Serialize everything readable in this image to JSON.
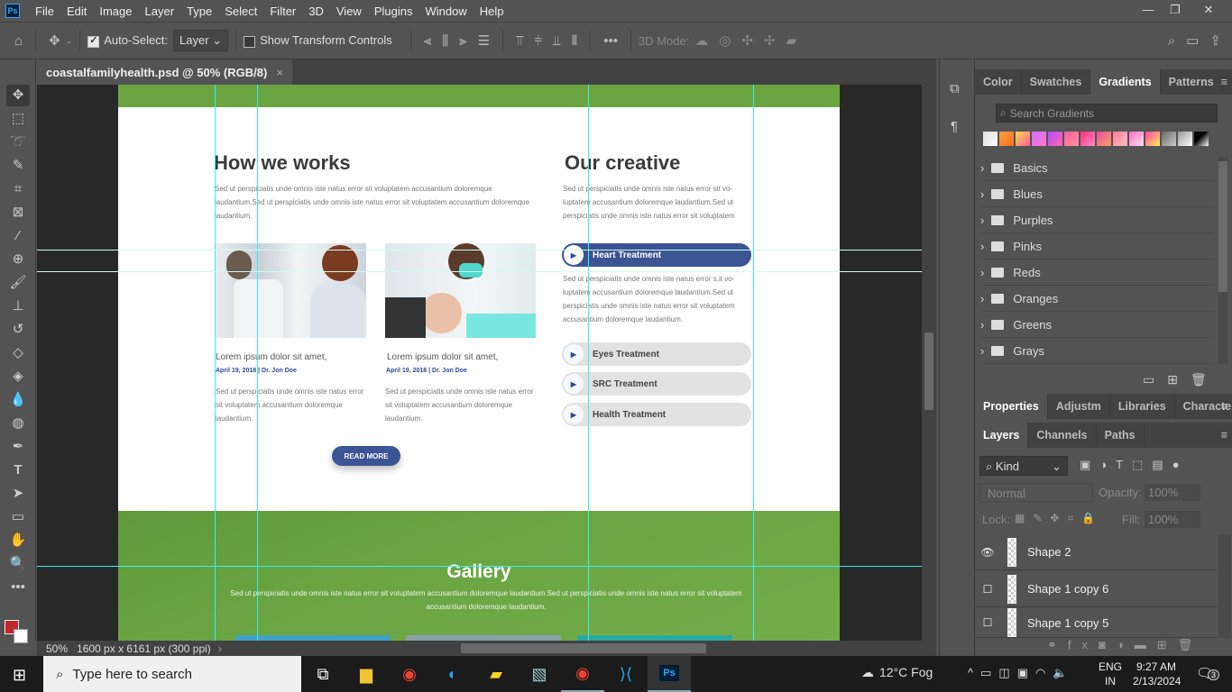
{
  "app": {
    "logo": "Ps",
    "menu": [
      "File",
      "Edit",
      "Image",
      "Layer",
      "Type",
      "Select",
      "Filter",
      "3D",
      "View",
      "Plugins",
      "Window",
      "Help"
    ]
  },
  "options": {
    "auto_select_label": "Auto-Select:",
    "auto_select_checked": true,
    "layer_select": "Layer",
    "show_transform_label": "Show Transform Controls",
    "show_transform_checked": false,
    "mode_3d_label": "3D Mode:"
  },
  "document": {
    "tab_title": "coastalfamilyhealth.psd @ 50% (RGB/8)",
    "close": "×"
  },
  "canvas": {
    "how": {
      "title": "How we works",
      "intro": "Sed ut perspiciatis unde omnis iste natus error sit voluptatem accusantium doloremque laudantium.Sed ut perspiciatis unde omnis iste natus error sit voluptatem accusantium doloremque laudantium.",
      "posts": [
        {
          "title": "Lorem ipsum dolor sit amet,",
          "date": "April 19, 2018",
          "sep": "|",
          "author": "Dr. Jon Doe",
          "text": "Sed ut perspiciatis unde omnis iste natus error sit voluptatem accusantium doloremque laudantium."
        },
        {
          "title": "Lorem ipsum dolor sit amet,",
          "date": "April 19, 2018",
          "sep": "|",
          "author": "Dr. Jon Doe",
          "text": "Sed ut perspiciatis unde omnis iste natus error sit voluptatem accusantium doloremque laudantium."
        }
      ],
      "read_more": "READ MORE"
    },
    "creative": {
      "title": "Our creative",
      "intro": "Sed ut perspiciatis unde omnis iste natus error sit vo-luptatem accusantium doloremque laudantium.Sed ut perspiciatis unde omnis iste natus error sit voluptatem",
      "items": [
        {
          "label": "Heart Treatment",
          "active": true
        },
        {
          "label": "Eyes Treatment"
        },
        {
          "label": "SRC Treatment"
        },
        {
          "label": "Health Treatment"
        }
      ],
      "active_text": "Sed ut perspiciatis unde omnis iste natus error s.it vo-luptatem accusantium doloremque laudantium.Sed ut perspiciatis unde omnis iste natus error sit voluptatem accusantium doloremque laudantium."
    },
    "gallery": {
      "title": "Gallery",
      "text": "Sed ut perspiciatis unde omnis iste natus error sit voluptatem accusantium doloremque laudantium.Sed ut perspiciatis unde omnis iste natus error sit voluptatem accusantium doloremque laudantium."
    }
  },
  "status": {
    "zoom": "50%",
    "doc_info": "1600 px x 6161 px (300 ppi)"
  },
  "gradients_panel": {
    "tabs": [
      "Color",
      "Swatches",
      "Gradients",
      "Patterns"
    ],
    "active": "Gradients",
    "search_placeholder": "Search Gradients",
    "folders": [
      "Basics",
      "Blues",
      "Purples",
      "Pinks",
      "Reds",
      "Oranges",
      "Greens",
      "Grays"
    ]
  },
  "properties_panel": {
    "tabs": [
      "Properties",
      "Adjustm",
      "Libraries",
      "Characte"
    ]
  },
  "layers_panel": {
    "tabs": [
      "Layers",
      "Channels",
      "Paths"
    ],
    "filter": "Kind",
    "blend": "Normal",
    "opacity_label": "Opacity:",
    "opacity": "100%",
    "lock_label": "Lock:",
    "fill_label": "Fill:",
    "fill": "100%",
    "layers": [
      {
        "name": "Shape 2",
        "visible": true
      },
      {
        "name": "Shape 1 copy 6",
        "visible": false
      },
      {
        "name": "Shape 1 copy 5",
        "visible": false
      }
    ]
  },
  "taskbar": {
    "search_placeholder": "Type here to search",
    "weather": "12°C  Fog",
    "lang1": "ENG",
    "lang2": "IN",
    "time": "9:27 AM",
    "date": "2/13/2024",
    "notifications": "3"
  },
  "colors": {
    "accent": "#3b5494",
    "green": "#6aa542",
    "guide": "#35f0f0",
    "foreground": "#c1272d"
  }
}
